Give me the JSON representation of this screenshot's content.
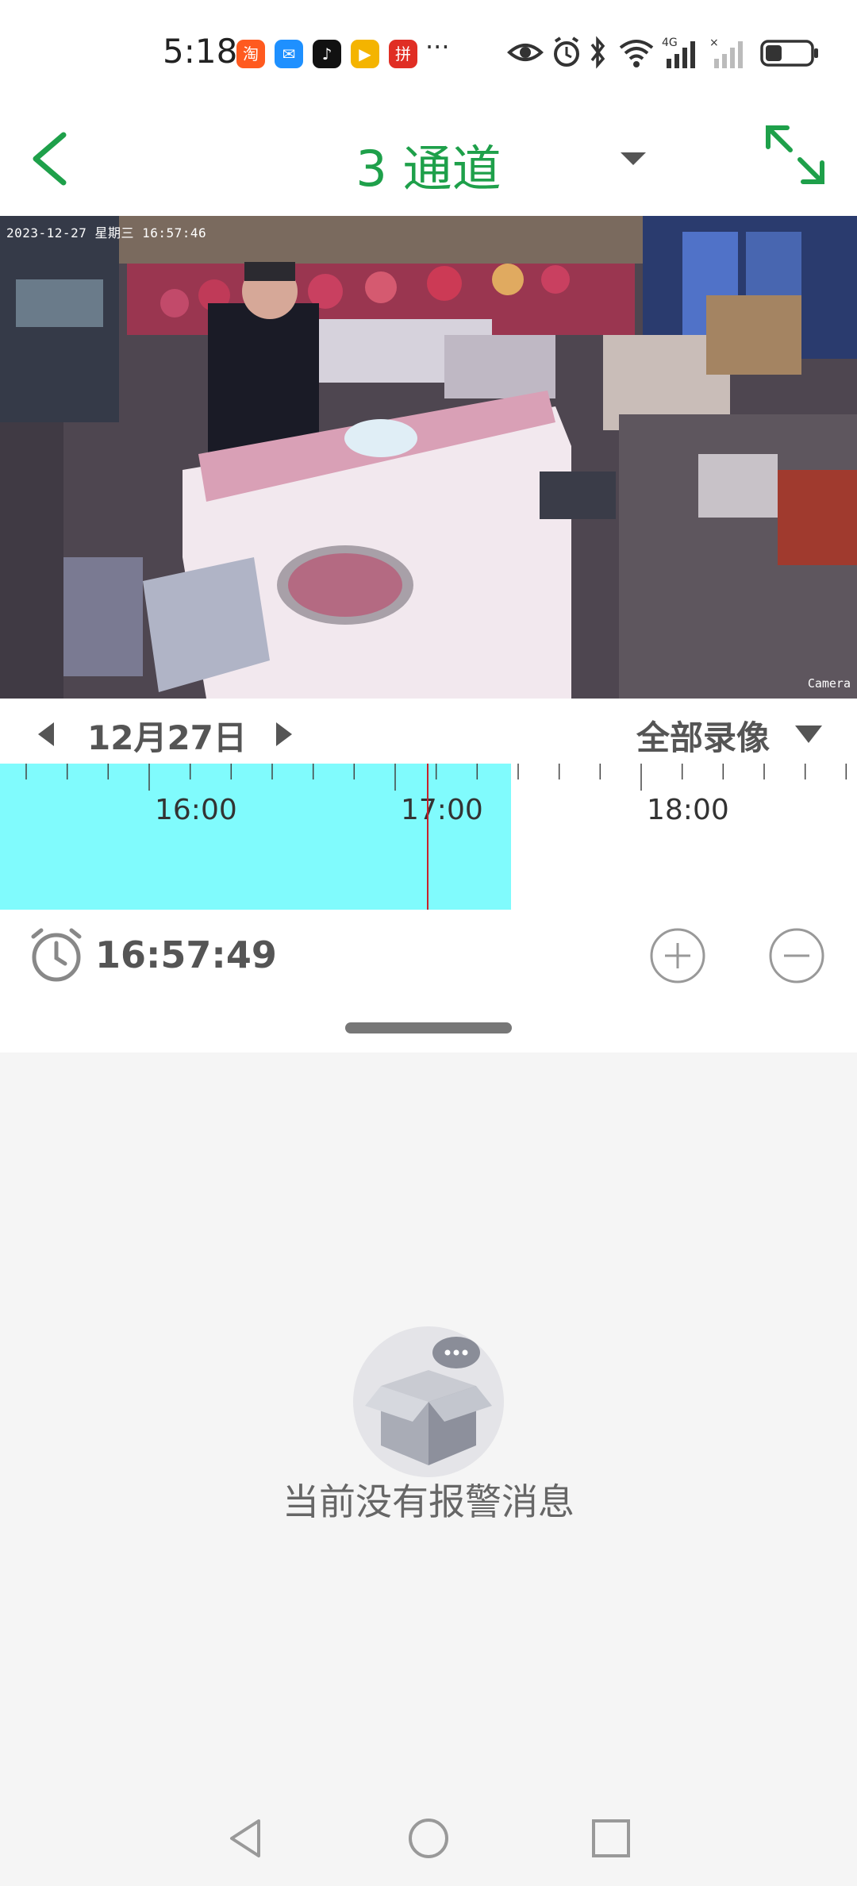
{
  "status_bar": {
    "time": "5:18",
    "overflow_dots": "···",
    "apps": [
      {
        "name": "taobao-app-icon",
        "glyph": "淘",
        "color": "#ff5a1f"
      },
      {
        "name": "message-app-icon",
        "glyph": "✉",
        "color": "#1e90ff"
      },
      {
        "name": "tiktok-app-icon",
        "glyph": "♪",
        "color": "#111111"
      },
      {
        "name": "store-app-icon",
        "glyph": "▶",
        "color": "#f4b400"
      },
      {
        "name": "pinduoduo-app-icon",
        "glyph": "拼",
        "color": "#e02e24"
      }
    ]
  },
  "header": {
    "title": "3 通道",
    "accent": "#1ea04a"
  },
  "video": {
    "overlay_text": "2023-12-27  星期三  16:57:46",
    "camera_label": "Camera"
  },
  "playback": {
    "date": "12月27日",
    "filter": "全部录像",
    "timeline_labels": [
      "16:00",
      "17:00",
      "18:00"
    ],
    "current_time": "16:57:49"
  },
  "messages": {
    "empty_text": "当前没有报警消息"
  }
}
